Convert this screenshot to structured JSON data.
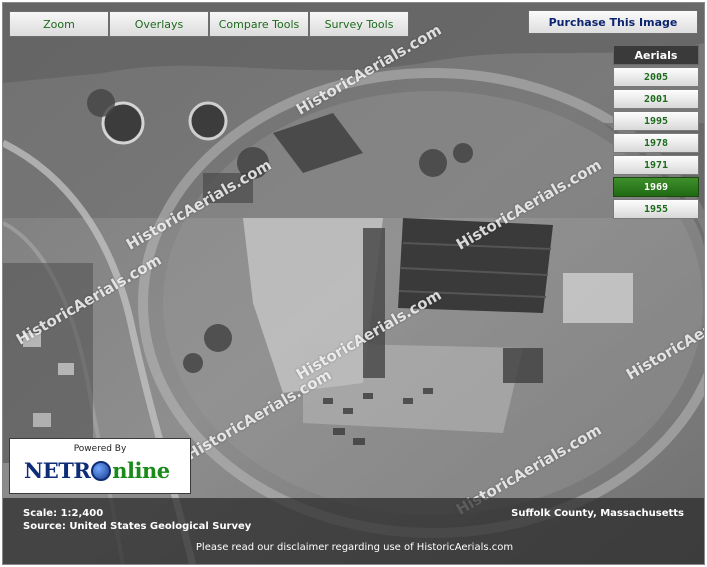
{
  "toolbar": {
    "zoom": "Zoom",
    "overlays": "Overlays",
    "compare_tools": "Compare Tools",
    "survey_tools": "Survey Tools"
  },
  "purchase_button": "Purchase This Image",
  "aerials": {
    "title": "Aerials",
    "years": [
      {
        "label": "2005",
        "selected": false
      },
      {
        "label": "2001",
        "selected": false
      },
      {
        "label": "1995",
        "selected": false
      },
      {
        "label": "1978",
        "selected": false
      },
      {
        "label": "1971",
        "selected": false
      },
      {
        "label": "1969",
        "selected": true
      },
      {
        "label": "1955",
        "selected": false
      }
    ]
  },
  "logo": {
    "powered_by": "Powered By",
    "brand_part1": "NETR",
    "brand_part2": "nline"
  },
  "info": {
    "scale": "Scale: 1:2,400",
    "source": "Source: United States Geological Survey",
    "county": "Suffolk County, Massachusetts",
    "disclaimer": "Please read our disclaimer regarding use of HistoricAerials.com"
  },
  "watermark_text": "HistoricAerials.com",
  "colors": {
    "year_text": "#1c6b1c",
    "year_selected": "#2d7d1e",
    "purchase_text": "#0d2470",
    "tool_text": "#1d6a1d"
  }
}
